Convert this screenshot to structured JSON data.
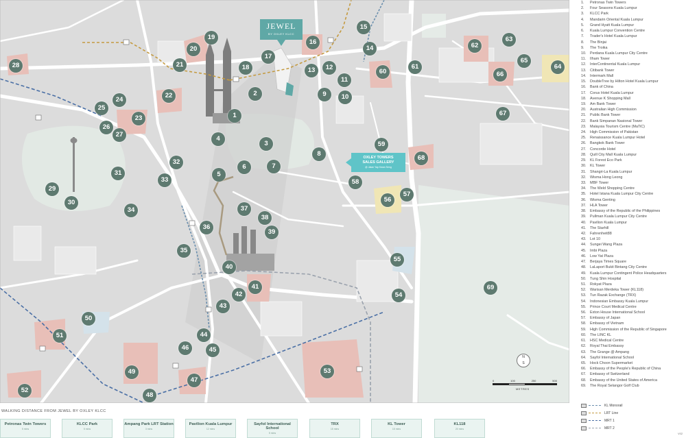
{
  "map": {
    "landmark_markers": [
      {
        "num": "1"
      },
      {
        "num": "2"
      },
      {
        "num": "3"
      },
      {
        "num": "4"
      },
      {
        "num": "5"
      },
      {
        "num": "6"
      },
      {
        "num": "7"
      },
      {
        "num": "8"
      },
      {
        "num": "9"
      },
      {
        "num": "10"
      },
      {
        "num": "11"
      },
      {
        "num": "12"
      },
      {
        "num": "13"
      },
      {
        "num": "14"
      },
      {
        "num": "15"
      },
      {
        "num": "16"
      },
      {
        "num": "17"
      },
      {
        "num": "18"
      },
      {
        "num": "19"
      },
      {
        "num": "20"
      },
      {
        "num": "21"
      },
      {
        "num": "22"
      },
      {
        "num": "23"
      },
      {
        "num": "24"
      },
      {
        "num": "25"
      },
      {
        "num": "26"
      },
      {
        "num": "27"
      },
      {
        "num": "28"
      },
      {
        "num": "29"
      },
      {
        "num": "30"
      },
      {
        "num": "31"
      },
      {
        "num": "32"
      },
      {
        "num": "33"
      },
      {
        "num": "34"
      },
      {
        "num": "35"
      },
      {
        "num": "36"
      },
      {
        "num": "37"
      },
      {
        "num": "38"
      },
      {
        "num": "39"
      },
      {
        "num": "40"
      },
      {
        "num": "41"
      },
      {
        "num": "42"
      },
      {
        "num": "43"
      },
      {
        "num": "44"
      },
      {
        "num": "45"
      },
      {
        "num": "46"
      },
      {
        "num": "47"
      },
      {
        "num": "48"
      },
      {
        "num": "49"
      },
      {
        "num": "50"
      },
      {
        "num": "51"
      },
      {
        "num": "52"
      },
      {
        "num": "53"
      },
      {
        "num": "54"
      },
      {
        "num": "55"
      },
      {
        "num": "56"
      },
      {
        "num": "57"
      },
      {
        "num": "58"
      },
      {
        "num": "59"
      },
      {
        "num": "60"
      },
      {
        "num": "61"
      },
      {
        "num": "62"
      },
      {
        "num": "63"
      },
      {
        "num": "64"
      },
      {
        "num": "65"
      },
      {
        "num": "66"
      },
      {
        "num": "67"
      },
      {
        "num": "68"
      },
      {
        "num": "69"
      }
    ],
    "jewel_badge": {
      "title": "JEWEL",
      "sub": "BY OXLEY KLCC"
    },
    "oxley_badge": {
      "line1": "OXLEY TOWERS",
      "line2": "SALES GALLERY",
      "sub": "@ Jalan Yap Kwan Seng"
    },
    "compass": {
      "north": "N",
      "south": "S"
    },
    "scale": {
      "ticks": [
        "0",
        "100",
        "250",
        "500"
      ],
      "unit": "METRES"
    },
    "colors": {
      "base": "#dcdcdc",
      "marker": "#5e7a70",
      "accent": "#5fa8a6",
      "monorail": "#6b8fae",
      "lrt": "#c49a40"
    }
  },
  "legend": [
    {
      "num": "1.",
      "name": "Petronas Twin Towers"
    },
    {
      "num": "2.",
      "name": "Four Seasons Kuala Lumpur"
    },
    {
      "num": "3.",
      "name": "KLCC Park"
    },
    {
      "num": "4.",
      "name": "Mandarin Oriental Kuala Lumpur"
    },
    {
      "num": "5.",
      "name": "Grand Hyatt Kuala Lumpur"
    },
    {
      "num": "6.",
      "name": "Kuala Lumpur Convention Centre"
    },
    {
      "num": "7.",
      "name": "Trader's Hotel Kuala Lumpur"
    },
    {
      "num": "8.",
      "name": "The Binjai"
    },
    {
      "num": "9.",
      "name": "The Troika"
    },
    {
      "num": "10.",
      "name": "Perdana Kuala Lumpur City Centre"
    },
    {
      "num": "11.",
      "name": "Ilham Tower"
    },
    {
      "num": "12.",
      "name": "InterContinental Kuala Lumpur"
    },
    {
      "num": "13.",
      "name": "Citibank Tower"
    },
    {
      "num": "14.",
      "name": "Intermark Mall"
    },
    {
      "num": "15.",
      "name": "DoubleTree by Hilton Hotel Kuala Lumpur"
    },
    {
      "num": "16.",
      "name": "Bank of China"
    },
    {
      "num": "17.",
      "name": "Corus Hotel Kuala Lumpur"
    },
    {
      "num": "18.",
      "name": "Avenue K Shopping Mall"
    },
    {
      "num": "19.",
      "name": "Am Bank Tower"
    },
    {
      "num": "20.",
      "name": "Australian High Commission"
    },
    {
      "num": "21.",
      "name": "Public Bank Tower"
    },
    {
      "num": "22.",
      "name": "Bank Simpanan Nasional Tower"
    },
    {
      "num": "23.",
      "name": "Malaysia Tourism Centre (MaTiC)"
    },
    {
      "num": "24.",
      "name": "High Commission of Pakistan"
    },
    {
      "num": "25.",
      "name": "Renaissance Kuala Lumpur Hotel"
    },
    {
      "num": "26.",
      "name": "Bangkok Bank Tower"
    },
    {
      "num": "27.",
      "name": "Concorde Hotel"
    },
    {
      "num": "28.",
      "name": "Quill City Mall Kuala Lumpur"
    },
    {
      "num": "29.",
      "name": "KL Forest Eco Park"
    },
    {
      "num": "30.",
      "name": "KL Tower"
    },
    {
      "num": "31.",
      "name": "Shangri-La Kuala Lumpur"
    },
    {
      "num": "32.",
      "name": "Wisma Hong Leong"
    },
    {
      "num": "33.",
      "name": "MBF Tower"
    },
    {
      "num": "34.",
      "name": "The Weld Shopping Centre"
    },
    {
      "num": "35.",
      "name": "Hotel Istana Kuala Lumpur City Centre"
    },
    {
      "num": "36.",
      "name": "Wisma Genting"
    },
    {
      "num": "37.",
      "name": "HLA Tower"
    },
    {
      "num": "38.",
      "name": "Embassy of the Republic of the Philippines"
    },
    {
      "num": "39.",
      "name": "Pullman Kuala Lumpur City Centre"
    },
    {
      "num": "40.",
      "name": "Pavilion Kuala Lumpur"
    },
    {
      "num": "41.",
      "name": "The Starhill"
    },
    {
      "num": "42.",
      "name": "Fahrenheit88"
    },
    {
      "num": "43.",
      "name": "Lot 10"
    },
    {
      "num": "44.",
      "name": "Sungei Wang Plaza"
    },
    {
      "num": "45.",
      "name": "Imbi Plaza"
    },
    {
      "num": "46.",
      "name": "Low Yat Plaza"
    },
    {
      "num": "47.",
      "name": "Berjaya Times Square"
    },
    {
      "num": "48.",
      "name": "LaLaport Bukit Bintang City Centre"
    },
    {
      "num": "49.",
      "name": "Kuala Lumpur Contingent Police Headquarters"
    },
    {
      "num": "50.",
      "name": "Tung Shin Hospital"
    },
    {
      "num": "51.",
      "name": "Rokyat Plaza"
    },
    {
      "num": "52.",
      "name": "Warisan Merdeka Tower (KL118)"
    },
    {
      "num": "53.",
      "name": "Tun Razak Exchange (TRX)"
    },
    {
      "num": "54.",
      "name": "Indonesian Embassy Kuala Lumpur"
    },
    {
      "num": "55.",
      "name": "Prince Court Medical Centre"
    },
    {
      "num": "56.",
      "name": "Exton House International School"
    },
    {
      "num": "57.",
      "name": "Embassy of Japan"
    },
    {
      "num": "58.",
      "name": "Embassy of Vietnam"
    },
    {
      "num": "59.",
      "name": "High Commission of the Republic of Singapore"
    },
    {
      "num": "60.",
      "name": "The LINC KL"
    },
    {
      "num": "61.",
      "name": "HSC Medical Centre"
    },
    {
      "num": "62.",
      "name": "Royal Thai Embassy"
    },
    {
      "num": "63.",
      "name": "The Grange @ Ampang"
    },
    {
      "num": "64.",
      "name": "Sayfol International School"
    },
    {
      "num": "65.",
      "name": "Hock Choon Supermarket"
    },
    {
      "num": "66.",
      "name": "Embassy of the People's Republic of China"
    },
    {
      "num": "67.",
      "name": "Embassy of Switzerland"
    },
    {
      "num": "68.",
      "name": "Embassy of the United States of America"
    },
    {
      "num": "69.",
      "name": "The Royal Selangor Golf Club"
    }
  ],
  "transit_legend": [
    {
      "label": "KL Monorail",
      "color": "#6b8fae",
      "dash": "3 2"
    },
    {
      "label": "LRT Line",
      "color": "#c49a40",
      "dash": "3 2"
    },
    {
      "label": "MRT 1",
      "color": "#4a6fa5",
      "dash": "4 2"
    },
    {
      "label": "MRT 2",
      "color": "#9aa2ad",
      "dash": "4 2"
    }
  ],
  "footer": {
    "title": "WALKING DISTANCE FROM JEWEL BY OXLEY KLCC",
    "items": [
      {
        "label": "Petronas Twin Towers",
        "sub": "5 mins"
      },
      {
        "label": "KLCC Park",
        "sub": "5 mins"
      },
      {
        "label": "Ampang Park LRT Station",
        "sub": "3 mins"
      },
      {
        "label": "Pavilion Kuala Lumpur",
        "sub": "12 mins"
      },
      {
        "label": "Sayfol International School",
        "sub": "5 mins"
      },
      {
        "label": "TRX",
        "sub": "15 mins"
      },
      {
        "label": "KL Tower",
        "sub": "15 mins"
      },
      {
        "label": "KL118",
        "sub": "20 mins"
      }
    ]
  },
  "version": "V02"
}
